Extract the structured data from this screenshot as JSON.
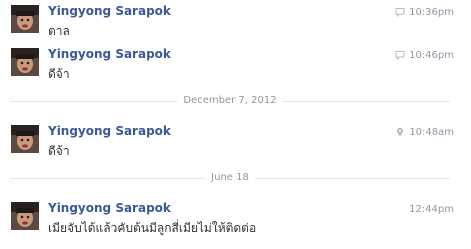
{
  "messages": [
    {
      "sender": "Yingyong Sarapok",
      "text": "ตาล",
      "time": "10:36pm",
      "meta_icon": "chat-bubble-icon"
    },
    {
      "sender": "Yingyong Sarapok",
      "text": "ดีจ้า",
      "time": "10:46pm",
      "meta_icon": "chat-bubble-icon"
    },
    {
      "sender": "Yingyong Sarapok",
      "text": "ดีจ้า",
      "time": "10:48am",
      "meta_icon": "location-pin-icon"
    },
    {
      "sender": "Yingyong Sarapok",
      "text": "เมียจับได้แล้วคับต้นมีลูกสี่เมียไม่ให้ติดต่อ",
      "time": "12:44pm",
      "meta_icon": ""
    }
  ],
  "dividers": [
    {
      "label": "December 7, 2012"
    },
    {
      "label": "June 18"
    }
  ],
  "colors": {
    "sender_link": "#3b5998",
    "message_text": "#333333",
    "meta_text": "#9197a3",
    "divider_line": "#e5e5e5"
  }
}
